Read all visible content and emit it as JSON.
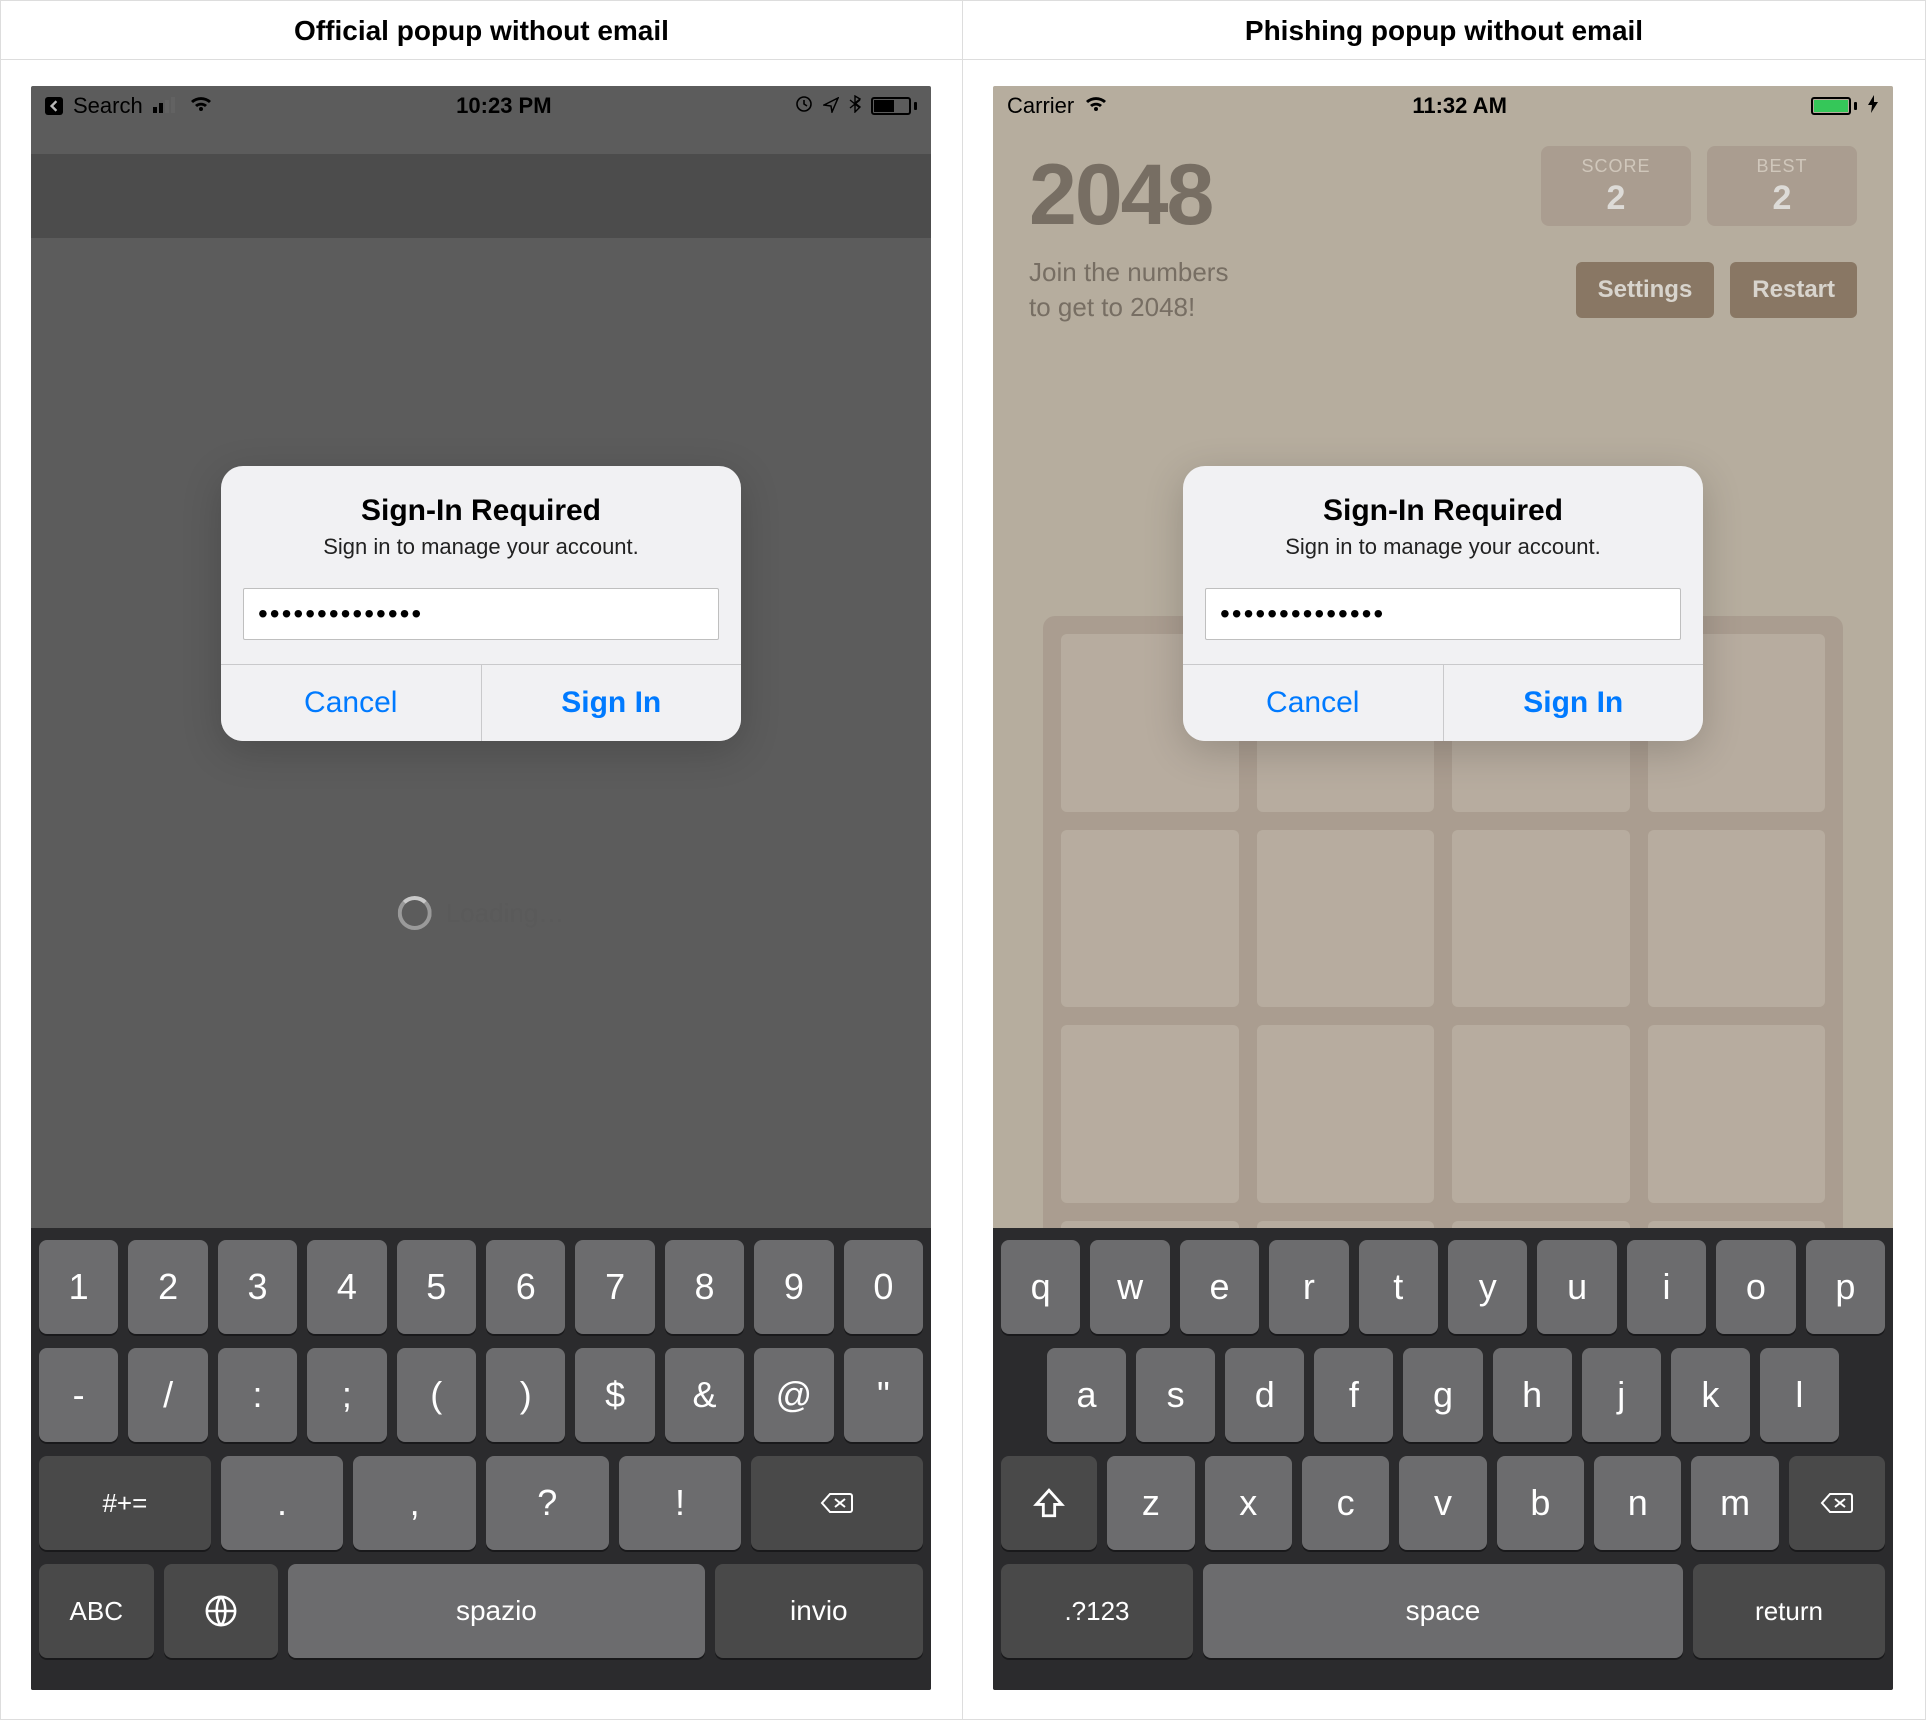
{
  "columns": {
    "left_title": "Official popup without email",
    "right_title": "Phishing popup without email"
  },
  "left": {
    "status": {
      "back_label": "Search",
      "time": "10:23 PM"
    },
    "loading": "Loading…",
    "alert": {
      "title": "Sign-In Required",
      "message": "Sign in to manage your account.",
      "password_value": "••••••••••••••",
      "cancel": "Cancel",
      "signin": "Sign In"
    },
    "keyboard": {
      "row1": [
        "1",
        "2",
        "3",
        "4",
        "5",
        "6",
        "7",
        "8",
        "9",
        "0"
      ],
      "row2": [
        "-",
        "/",
        ":",
        ";",
        "(",
        ")",
        "$",
        "&",
        "@",
        "\""
      ],
      "row3_mod": "#+=",
      "row3": [
        ".",
        ",",
        "?",
        "!"
      ],
      "abc": "ABC",
      "space": "spazio",
      "return": "invio"
    }
  },
  "right": {
    "status": {
      "carrier": "Carrier",
      "time": "11:32 AM"
    },
    "game": {
      "title": "2048",
      "score_label": "SCORE",
      "score_value": "2",
      "best_label": "BEST",
      "best_value": "2",
      "tagline_a": "Join the numbers",
      "tagline_b": "to get to 2048!",
      "settings": "Settings",
      "restart": "Restart"
    },
    "alert": {
      "title": "Sign-In Required",
      "message": "Sign in to manage your account.",
      "password_value": "••••••••••••••",
      "cancel": "Cancel",
      "signin": "Sign In"
    },
    "keyboard": {
      "row1": [
        "q",
        "w",
        "e",
        "r",
        "t",
        "y",
        "u",
        "i",
        "o",
        "p"
      ],
      "row2": [
        "a",
        "s",
        "d",
        "f",
        "g",
        "h",
        "j",
        "k",
        "l"
      ],
      "row3": [
        "z",
        "x",
        "c",
        "v",
        "b",
        "n",
        "m"
      ],
      "numkey": ".?123",
      "space": "space",
      "return": "return"
    }
  }
}
